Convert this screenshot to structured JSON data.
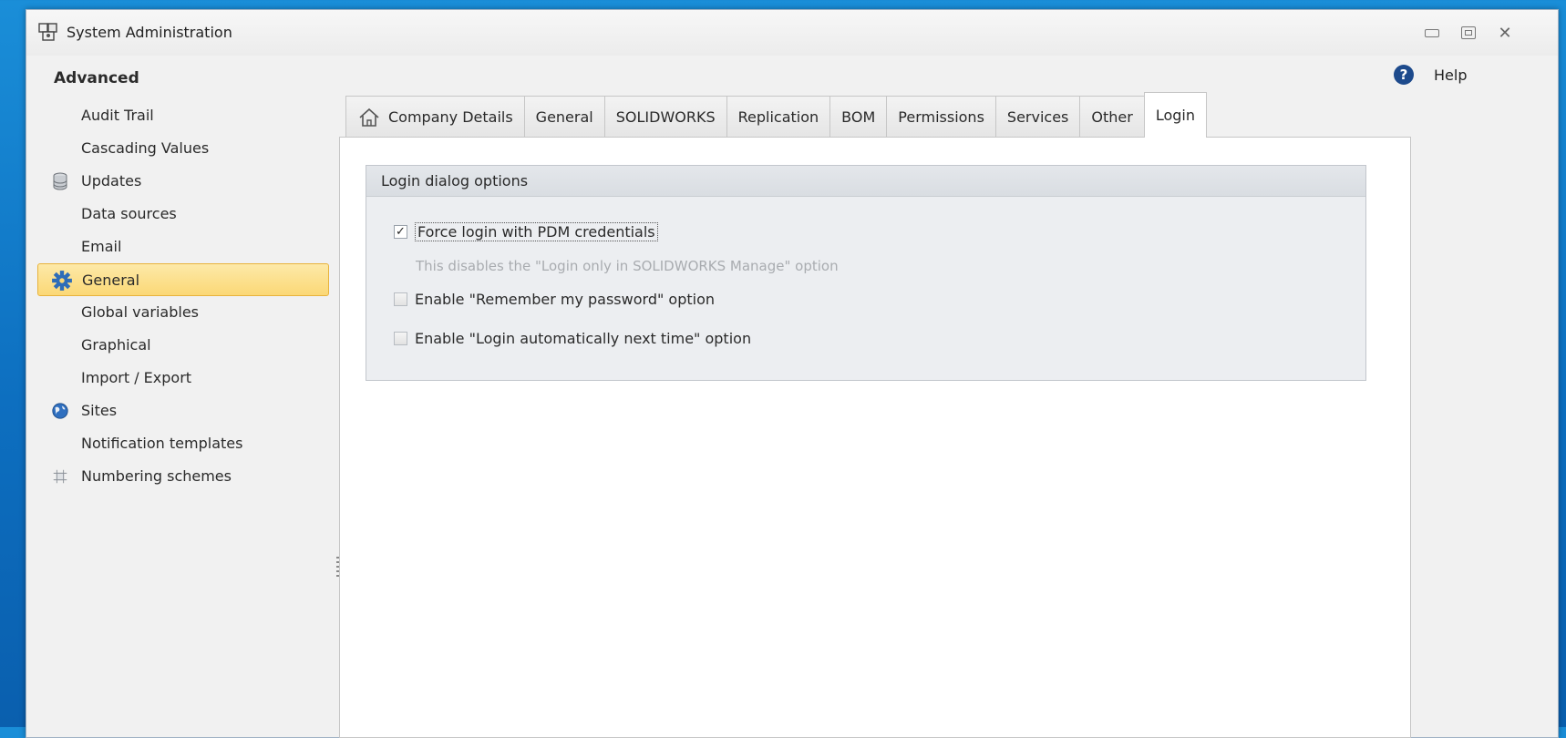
{
  "window": {
    "title": "System Administration",
    "controls": {
      "minimize": "minimize",
      "maximize": "maximize",
      "close": "✕"
    }
  },
  "header": {
    "section_title": "Advanced",
    "help_label": "Help",
    "help_glyph": "?"
  },
  "sidebar": {
    "items": [
      {
        "label": "Audit Trail",
        "icon": ""
      },
      {
        "label": "Cascading Values",
        "icon": ""
      },
      {
        "label": "Updates",
        "icon": "database-icon"
      },
      {
        "label": "Data sources",
        "icon": ""
      },
      {
        "label": "Email",
        "icon": ""
      },
      {
        "label": "General",
        "icon": "gear-icon",
        "selected": true
      },
      {
        "label": "Global variables",
        "icon": ""
      },
      {
        "label": "Graphical",
        "icon": ""
      },
      {
        "label": "Import / Export",
        "icon": ""
      },
      {
        "label": "Sites",
        "icon": "globe-icon"
      },
      {
        "label": "Notification templates",
        "icon": ""
      },
      {
        "label": "Numbering schemes",
        "icon": "grid-icon"
      }
    ]
  },
  "tabs": [
    {
      "label": "Company Details",
      "icon": "home-icon"
    },
    {
      "label": "General"
    },
    {
      "label": "SOLIDWORKS"
    },
    {
      "label": "Replication"
    },
    {
      "label": "BOM"
    },
    {
      "label": "Permissions"
    },
    {
      "label": "Services"
    },
    {
      "label": "Other"
    },
    {
      "label": "Login",
      "active": true
    }
  ],
  "login_group": {
    "title": "Login dialog options",
    "force_login": {
      "label": "Force login with PDM credentials",
      "checked": true
    },
    "hint": "This disables the \"Login only in SOLIDWORKS Manage\" option",
    "remember_password": {
      "label": "Enable \"Remember my password\" option",
      "checked": false
    },
    "login_automatically": {
      "label": "Enable \"Login automatically next time\" option",
      "checked": false
    }
  },
  "colors": {
    "desktop": "#1a8ed8",
    "selected_item": "#fbd876",
    "selected_border": "#e8b33c",
    "group_bg": "#eceef1"
  }
}
